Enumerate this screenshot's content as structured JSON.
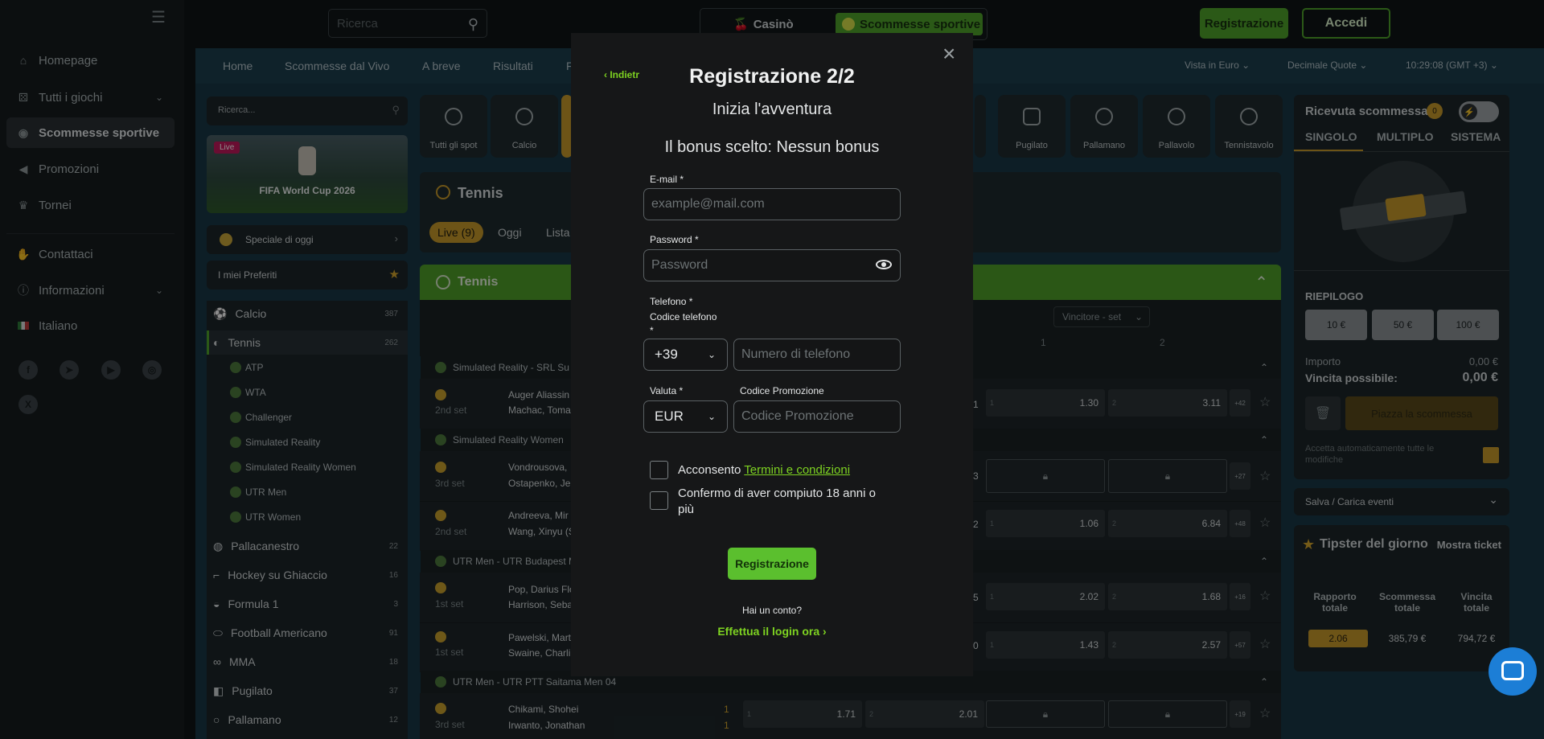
{
  "sidebar": {
    "items": [
      {
        "label": "Homepage",
        "icon": "home-icon"
      },
      {
        "label": "Tutti i giochi",
        "icon": "dice-icon"
      },
      {
        "label": "Scommesse sportive",
        "icon": "football-icon"
      },
      {
        "label": "Promozioni",
        "icon": "megaphone-icon"
      },
      {
        "label": "Tornei",
        "icon": "trophy-icon"
      },
      {
        "label": "Contattaci",
        "icon": "handshake-icon"
      },
      {
        "label": "Informazioni",
        "icon": "info-icon"
      },
      {
        "label": "Italiano",
        "icon": "italy-flag-icon"
      }
    ]
  },
  "topbar": {
    "search_placeholder": "Ricerca",
    "casino": "Casinò",
    "sports": "Scommesse sportive",
    "register": "Registrazione",
    "login": "Accedi"
  },
  "mainnav": {
    "items": [
      "Home",
      "Scommesse dal Vivo",
      "A breve",
      "Risultati",
      "F"
    ],
    "currency_view": "Vista in Euro",
    "odds_format": "Decimale Quote",
    "time": "10:29:08 (GMT +3)"
  },
  "leftpanel": {
    "search_placeholder": "Ricerca...",
    "banner_badge": "Live",
    "banner_title": "FIFA World Cup 2026",
    "special": "Speciale di oggi",
    "favorites": "I miei Preferiti",
    "sports": [
      {
        "label": "Calcio",
        "count": "387"
      },
      {
        "label": "Tennis",
        "count": "262"
      },
      {
        "label": "Pallacanestro",
        "count": "22"
      },
      {
        "label": "Hockey su Ghiaccio",
        "count": "16"
      },
      {
        "label": "Formula 1",
        "count": "3"
      },
      {
        "label": "Football Americano",
        "count": "91"
      },
      {
        "label": "MMA",
        "count": "18"
      },
      {
        "label": "Pugilato",
        "count": "37"
      },
      {
        "label": "Pallamano",
        "count": "12"
      }
    ],
    "tennis_sub": [
      "ATP",
      "WTA",
      "Challenger",
      "Simulated Reality",
      "Simulated Reality Women",
      "UTR Men",
      "UTR Women"
    ]
  },
  "sport_tiles": {
    "left": [
      "Tutti gli spot",
      "Calcio"
    ],
    "right": [
      "Pugilato",
      "Pallamano",
      "Pallavolo",
      "Tennistavolo"
    ]
  },
  "tennis_header": {
    "title": "Tennis",
    "tabs": [
      "Live (9)",
      "Oggi",
      "Lista"
    ],
    "bar_title": "Tennis",
    "market": "Vincitore - set",
    "col1": "1",
    "col2": "2"
  },
  "groups": [
    {
      "name": "Simulated Reality - SRL Su"
    },
    {
      "name": "Simulated Reality Women"
    },
    {
      "name": "UTR Men - UTR Budapest M"
    },
    {
      "name": "UTR Men - UTR PTT Saitama Men 04"
    }
  ],
  "matches": [
    {
      "p1": "Auger Aliassin",
      "p2": "Machac, Toma",
      "set": "2nd set",
      "s": "1",
      "o1": "1.30",
      "o2": "3.11",
      "more": "+42"
    },
    {
      "p1": "Vondrousova,",
      "p2": "Ostapenko, Je",
      "set": "3rd set",
      "s": "3",
      "o1": "",
      "o2": "",
      "more": "+27"
    },
    {
      "p1": "Andreeva, Mir",
      "p2": "Wang, Xinyu (S",
      "set": "2nd set",
      "s": "2",
      "o1": "1.06",
      "o2": "6.84",
      "more": "+48"
    },
    {
      "p1": "Pop, Darius Flo",
      "p2": "Harrison, Seba",
      "set": "1st set",
      "s": "5",
      "o1": "2.02",
      "o2": "1.68",
      "more": "+16"
    },
    {
      "p1": "Pawelski, Mart",
      "p2": "Swaine, Charli",
      "set": "1st set",
      "s": "0",
      "o1": "1.43",
      "o2": "2.57",
      "more": "+57"
    },
    {
      "p1": "Chikami, Shohei",
      "p2": "Irwanto, Jonathan",
      "set": "3rd set",
      "s1": "1",
      "s2": "1",
      "a1": "1.71",
      "a2": "2.01",
      "more": "+19"
    }
  ],
  "odds_small": {
    "one": "1",
    "two": "2"
  },
  "betslip": {
    "title": "Ricevuta scommessa",
    "badge": "0",
    "tabs": [
      "SINGOLO",
      "MULTIPLO",
      "SISTEMA"
    ],
    "summary": "RIEPILOGO",
    "amounts": [
      "10 €",
      "50 €",
      "100 €"
    ],
    "importo_label": "Importo",
    "importo_value": "0,00 €",
    "win_label": "Vincita possibile:",
    "win_value": "0,00 €",
    "place_bet": "Piazza la scommessa",
    "auto_accept": "Accetta automaticamente tutte le modifiche",
    "save_load": "Salva / Carica eventi",
    "tipster_title": "Tipster del giorno",
    "tipster_link": "Mostra ticket",
    "tipster_cols": [
      "Rapporto totale",
      "Scommessa totale",
      "Vincita totale"
    ],
    "tipster_vals": [
      "2.06",
      "385,79 €",
      "794,72 €"
    ]
  },
  "modal": {
    "back": "Indietr",
    "title": "Registrazione 2/2",
    "subtitle": "Inizia l'avventura",
    "bonus": "Il bonus scelto: Nessun bonus",
    "email_label": "E-mail *",
    "email_placeholder": "example@mail.com",
    "password_label": "Password *",
    "password_placeholder": "Password",
    "phone_label": "Telefono *",
    "phone_code_label": "Codice telefono",
    "phone_code_star": "*",
    "phone_code_value": "+39",
    "phone_placeholder": "Numero di telefono",
    "currency_label": "Valuta *",
    "currency_value": "EUR",
    "promo_label": "Codice Promozione",
    "promo_placeholder": "Codice Promozione",
    "consent_prefix": "Acconsento",
    "consent_link": "Termini e condizioni",
    "age_confirm": "Confermo di aver compiuto 18 anni o più",
    "submit": "Registrazione",
    "have_account": "Hai un conto?",
    "login_now": "Effettua il login ora",
    "close": "×"
  },
  "colors": {
    "accent_green": "#4fa32a",
    "link_green": "#7ed321",
    "betslip_yellow": "#b38a1e",
    "chat_blue": "#1c7ed6"
  }
}
